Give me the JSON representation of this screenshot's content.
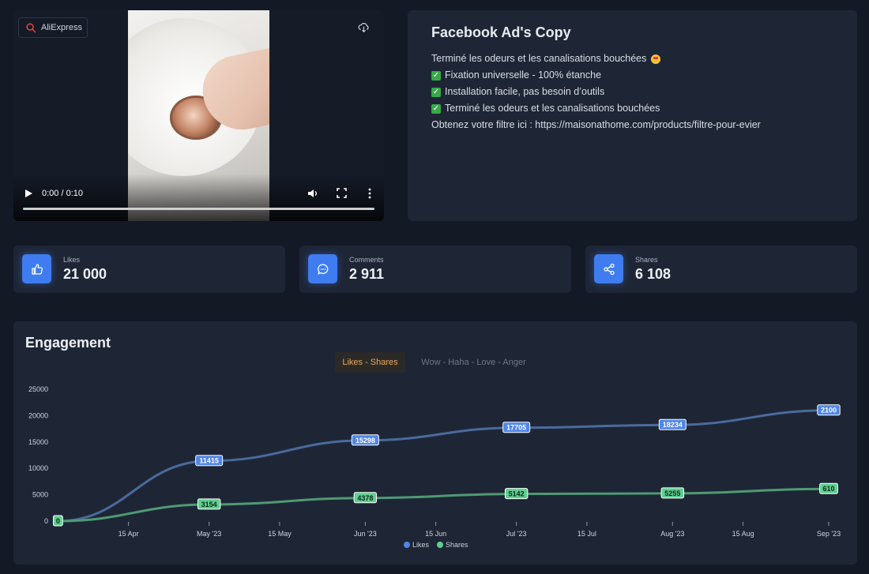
{
  "video": {
    "source_label": "AliExpress",
    "time": "0:00 / 0:10",
    "progress": 0
  },
  "ad_copy": {
    "title": "Facebook Ad's Copy",
    "lines": [
      "Terminé les odeurs et les canalisations bouchées",
      "Fixation universelle - 100% étanche",
      "Installation facile, pas besoin d’outils",
      "Terminé les odeurs et les canalisations bouchées",
      "Obtenez votre filtre ici : https://maisonathome.com/products/filtre-pour-evier"
    ]
  },
  "stats": [
    {
      "label": "Likes",
      "value": "21 000",
      "icon": "thumbs-up-icon"
    },
    {
      "label": "Comments",
      "value": "2 911",
      "icon": "comment-icon"
    },
    {
      "label": "Shares",
      "value": "6 108",
      "icon": "share-icon"
    }
  ],
  "engagement": {
    "title": "Engagement",
    "tabs": [
      "Likes - Shares",
      "Wow - Haha - Love - Anger"
    ],
    "active_tab": 0
  },
  "chart_data": {
    "type": "line",
    "title": "",
    "xlabel": "",
    "ylabel": "",
    "ylim": [
      0,
      25000
    ],
    "y_ticks": [
      "0",
      "5000",
      "10000",
      "15000",
      "20000",
      "25000"
    ],
    "x_ticks": [
      "15 Apr",
      "May '23",
      "15 May",
      "Jun '23",
      "15 Jun",
      "Jul '23",
      "15 Jul",
      "Aug '23",
      "15 Aug",
      "Sep '23"
    ],
    "x": [
      "2023-04-01",
      "2023-05-01",
      "2023-06-01",
      "2023-07-01",
      "2023-08-01",
      "2023-09-01"
    ],
    "series": [
      {
        "name": "Likes",
        "color": "#4f86e8",
        "line_color": "#4a6a9c",
        "values": [
          0,
          11415,
          15298,
          17705,
          18234,
          21000
        ],
        "labels": [
          "0",
          "11415",
          "15298",
          "17705",
          "18234",
          "2100"
        ]
      },
      {
        "name": "Shares",
        "color": "#5fcf8f",
        "line_color": "#4f9a73",
        "values": [
          0,
          3154,
          4378,
          5142,
          5255,
          6108
        ],
        "labels": [
          "0",
          "3154",
          "4378",
          "5142",
          "5255",
          "610"
        ]
      }
    ],
    "legend": "bottom-center",
    "grid": false
  }
}
